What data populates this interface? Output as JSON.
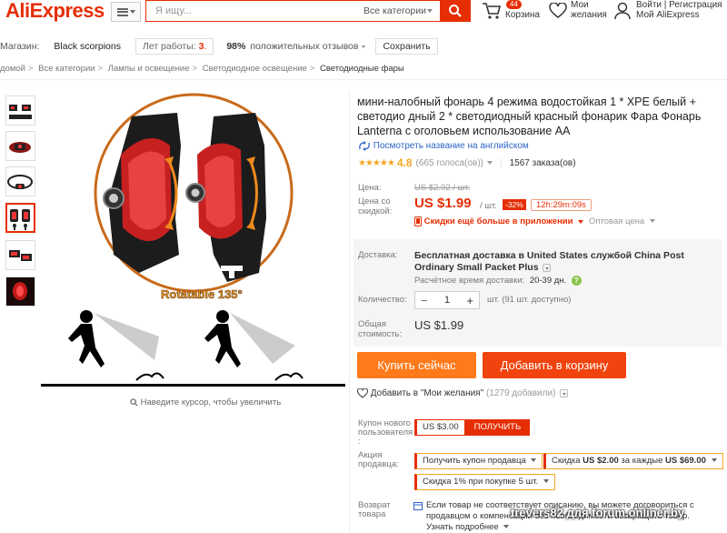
{
  "header": {
    "logo": "AliExpress",
    "search_placeholder": "Я ищу...",
    "search_category": "Все категории",
    "cart_count": "44",
    "cart_label": "Корзина",
    "wishlist_label_1": "Мои",
    "wishlist_label_2": "желания",
    "account_line_1": "Войти | Регистрация",
    "account_line_2": "Мой AliExpress"
  },
  "store": {
    "label": "Магазин:",
    "name": "Black scorpions",
    "years_label": "Лет работы:",
    "years_value": "3",
    "feedback_pct": "98%",
    "feedback_label": "положительных отзывов",
    "save_label": "Сохранить"
  },
  "breadcrumb": [
    "домой",
    "Все категории",
    "Лампы и освещение",
    "Светодиодное освещение",
    "Светодиодные фары"
  ],
  "gallery": {
    "zoom_hint": "Наведите курсор, чтобы увеличить",
    "image_text": "Rotatable 135°"
  },
  "product": {
    "title": "мини-налобный фонарь 4 режима водостойкая 1 * XPE белый + светодио дный 2 * светодиодный красный фонарик Фара Фонарь Lanterna с оголовьем использование AA",
    "translate_link": "Посмотреть название на английском",
    "rating": "4.8",
    "votes": "(665 голоса(ов))",
    "orders": "1567 заказа(ов)",
    "stars": "★★★★★",
    "price_label": "Цена:",
    "old_price": "US $2.92 / шт.",
    "discount_price_label": "Цена со скидкой:",
    "price": "US $1.99",
    "price_unit": "/ шт.",
    "discount": "-32%",
    "timer": "12h:29m:09s",
    "app_discount": "Скидки ещё больше в приложении",
    "wholesale": "Оптовая цена",
    "shipping_label": "Доставка:",
    "shipping_text": "Бесплатная доставка в United States службой China Post Ordinary Small Packet Plus",
    "shipping_time_label": "Расчётное время доставки:",
    "shipping_time": "20-39 дн.",
    "qty_label": "Количество:",
    "qty_value": "1",
    "qty_available": "шт. (91 шт. доступно)",
    "total_label": "Общая стоимость:",
    "total": "US $1.99",
    "buy_now": "Купить сейчас",
    "add_to_cart": "Добавить в корзину",
    "wishlist_add": "Добавить в \"Мои желания\"",
    "wishlist_count": "(1279 добавили)",
    "coupon_label": "Купон нового пользователя :",
    "coupon_value": "US $3.00",
    "coupon_button": "ПОЛУЧИТЬ",
    "promo_label": "Акция продавца:",
    "promo_1": "Получить купон продавца",
    "promo_2_prefix": "Скидка",
    "promo_2_amount": "US $2.00",
    "promo_2_mid": "за каждые",
    "promo_2_threshold": "US $69.00",
    "promo_3": "Скидка 1% при покупке 5 шт.",
    "return_label": "Возврат товара",
    "return_text": "Если товар не соответствует описанию, вы можете договориться с продавцом о компенсации без необходимости возвращать товар.",
    "return_more": "Узнать подробнее"
  },
  "watermark": "trevers82 для forum.onliner.by",
  "colors": {
    "brand": "#e62e04",
    "buy": "#ff7a1a",
    "cart": "#f0430e",
    "link": "#2d65c7"
  }
}
